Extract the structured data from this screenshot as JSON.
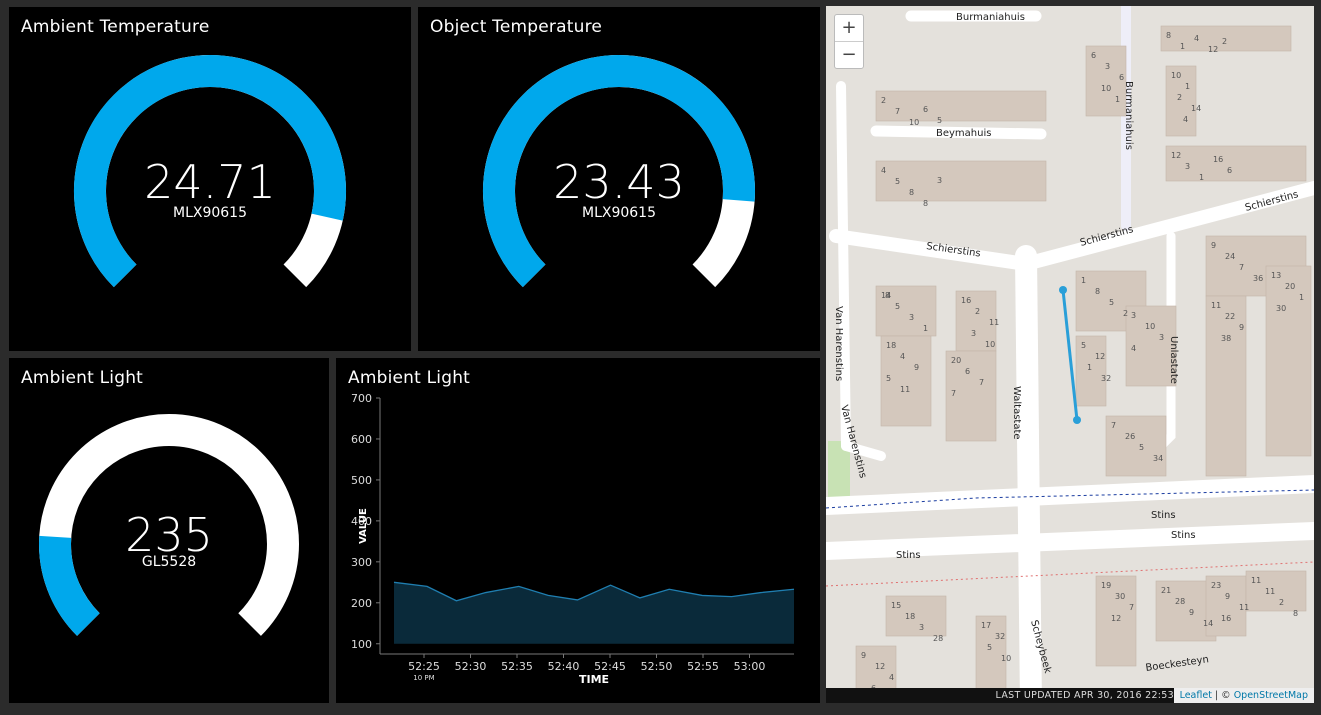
{
  "colors": {
    "accent": "#00a8ec",
    "track": "#ffffff",
    "panel": "#000000",
    "chart_fill": "#0a2a3a",
    "chart_line": "#1f7eb0"
  },
  "gauges": [
    {
      "title": "Ambient Temperature",
      "value": "24.71",
      "unit": "MLX90615",
      "fraction": 0.88
    },
    {
      "title": "Object Temperature",
      "value": "23.43",
      "unit": "MLX90615",
      "fraction": 0.85
    },
    {
      "title": "Ambient Light",
      "value": "235",
      "unit": "GL5528",
      "fraction": 0.18
    }
  ],
  "chart_panel": {
    "title": "Ambient Light"
  },
  "chart_data": {
    "type": "area",
    "title": "Ambient Light",
    "xlabel": "TIME",
    "ylabel": "VALUE",
    "ylim": [
      75,
      700
    ],
    "yticks": [
      100,
      200,
      300,
      400,
      500,
      600,
      700
    ],
    "xtick_labels": [
      "52:25",
      "52:30",
      "52:35",
      "52:40",
      "52:45",
      "52:50",
      "52:55",
      "53:00"
    ],
    "xtick_sublabel": "10 PM",
    "x_minutes": [
      52.08,
      52.17,
      52.25,
      52.33,
      52.42,
      52.5,
      52.58,
      52.67,
      52.75,
      52.83,
      52.92,
      53.0,
      53.08,
      53.17
    ],
    "values": [
      250,
      240,
      205,
      225,
      240,
      218,
      207,
      243,
      212,
      233,
      218,
      215,
      225,
      233
    ],
    "grid": false
  },
  "map": {
    "zoom_in": "+",
    "zoom_out": "−",
    "last_updated": "LAST UPDATED APR 30, 2016 22:53",
    "attribution_leaflet": "Leaflet",
    "attribution_sep": " | © ",
    "attribution_osm": "OpenStreetMap",
    "street_labels": [
      "Burmaniahuis",
      "Burmaniahuis",
      "Beymahuis",
      "Schierstins",
      "Schierstins",
      "Schierstins",
      "Van Harenstins",
      "Van Harenstins",
      "Waltastate",
      "Unlastate",
      "Stins",
      "Stins",
      "Stins",
      "Scheybeek",
      "Boeckesteyn"
    ],
    "house_numbers": [
      "2",
      "4",
      "6",
      "8",
      "10",
      "12",
      "14",
      "16",
      "18",
      "20",
      "1",
      "3",
      "5",
      "7",
      "9",
      "11",
      "13",
      "15",
      "17",
      "19",
      "21",
      "23",
      "11",
      "9",
      "7",
      "5",
      "3",
      "1",
      "1",
      "3",
      "5",
      "2",
      "4",
      "6",
      "8",
      "10",
      "12",
      "26",
      "24",
      "22",
      "20",
      "18",
      "32",
      "30",
      "28",
      "9",
      "11",
      "12",
      "10",
      "8",
      "6",
      "4",
      "2",
      "1",
      "3",
      "11",
      "9",
      "7",
      "5",
      "3",
      "1",
      "5",
      "7",
      "9",
      "1",
      "3",
      "5",
      "7",
      "9",
      "11",
      "2",
      "4",
      "6",
      "8",
      "10",
      "12",
      "14",
      "16",
      "1",
      "3",
      "5",
      "7",
      "2",
      "4",
      "32",
      "34",
      "36",
      "38",
      "30",
      "28",
      "10",
      "12",
      "14",
      "16",
      "8",
      "6",
      "5",
      "3",
      "1",
      "2",
      "4",
      "6",
      "8",
      "10",
      "11"
    ]
  }
}
